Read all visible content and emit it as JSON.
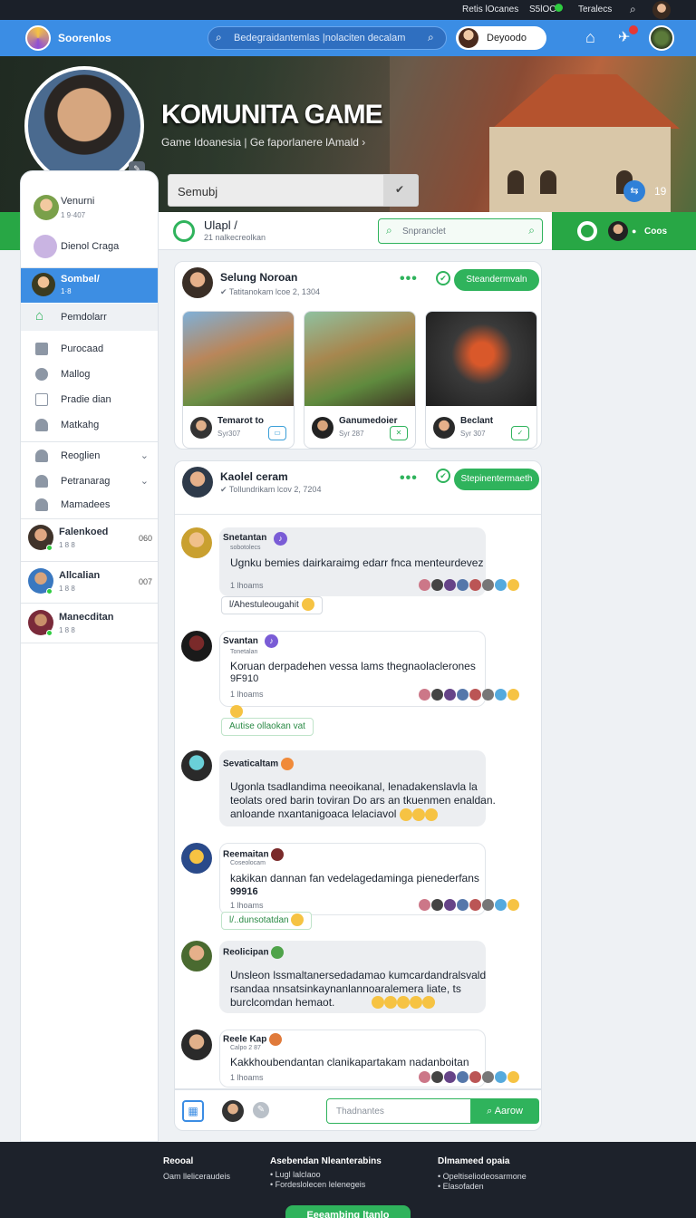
{
  "topbar": {
    "link1": "Retis lOcanes",
    "link2": "S5lOC",
    "link3": "Teralecs"
  },
  "appbar": {
    "brand": "Soorenlos",
    "search_placeholder": "Bedegraidantemlas |nolaciten decalam",
    "user_name": "Deyoodo"
  },
  "hero": {
    "title": "KOMUNITA GAME",
    "subtitle": "Game Idoanesia | Ge faporlanere lAmald",
    "input_value": "Semubj",
    "share_count": "19"
  },
  "sidebar": {
    "profile": {
      "name": "Venurni",
      "sub": "1 9·407"
    },
    "profile2": {
      "name": "Dienol Craga"
    },
    "active": {
      "name": "Sombel/",
      "sub": "1·8"
    },
    "home": "Pemdolarr",
    "menu": [
      "Purocaad",
      "Mallog",
      "Pradie dian",
      "Matkahg"
    ],
    "groups": [
      "Reoglien",
      "Petranarag",
      "Mamadees"
    ],
    "friends": [
      {
        "name": "Falenkoed",
        "sub": "1 8 8",
        "count": "060"
      },
      {
        "name": "Allcalian",
        "sub": "1 8 8",
        "count": "007"
      },
      {
        "name": "Manecditan",
        "sub": "1 8 8",
        "count": ""
      }
    ]
  },
  "main_header": {
    "title": "Ulapl /",
    "subtitle": "21 nalkecreolkan",
    "search_placeholder": "Snpranclet"
  },
  "right_band": {
    "label": "Coos"
  },
  "post1": {
    "author": "Selung Noroan",
    "meta": "Tatitanokam  lcoe 2, 1304",
    "action": "Steandermvaln",
    "thumbs": [
      {
        "name": "Temarot to",
        "sub": "Syr307"
      },
      {
        "name": "Ganumedoier",
        "sub": "Syr 287"
      },
      {
        "name": "Beclant",
        "sub": "Syr 307"
      }
    ]
  },
  "post2": {
    "author": "Kaolel ceram",
    "meta": "Tollundrikam  lcov 2, 7204",
    "action": "Stepinentermaeth"
  },
  "messages": [
    {
      "name": "Snetantan",
      "sub": "sobotolecs",
      "text": "Ugnku bemies dairkaraimg edarr fnca menteurdevez",
      "meta": "1 lhoams",
      "reply": "l/Ahestuleougahit"
    },
    {
      "name": "Svantan",
      "sub": "Tonetalan",
      "text": "Koruan derpadehen vessa lams thegnaolaclerones",
      "extra": "9F910",
      "meta": "1 lhoams",
      "reply": "Autise ollaokan vat"
    },
    {
      "name": "Sevaticaltam",
      "text1": "Ugonla tsadlandima neeoikanal, lenadakenslavla la",
      "text2": "teolats ored barin toviran Do ars an tkuenmen enaldan.",
      "text3": "anloande nxantanigoaca lelaciavol"
    },
    {
      "name": "Reemaitan",
      "sub": "Coseolocam",
      "text": "kakikan dannan fan vedelagedaminga pienederfans",
      "extra": "99916",
      "meta": "1 lhoams",
      "reply": "l/..dunsotatdan"
    },
    {
      "name": "Reolicipan",
      "text1": "Unsleon lssmaltanersedadamao kumcardandralsvald",
      "text2": "rsandaa nnsatsinkaynanlannoaralemera liate, ts",
      "text3": "burclcomdan hemaot."
    },
    {
      "name": "Reele Kap",
      "sub": "Calpo 2 87",
      "text": "Kakkhoubendantan clanikapartakam nadanboitan",
      "meta": "1 lhoams"
    }
  ],
  "compose": {
    "placeholder": "Thadnantes",
    "send_label": "Aarow"
  },
  "footer": {
    "col1": {
      "title": "Reooal",
      "line": "Oam lleliceraudeis"
    },
    "col2": {
      "title": "Asebendan Nleanterabins",
      "lines": [
        "Lugl lalclaoo",
        "Fordeslolecen lelenegeis"
      ]
    },
    "col3": {
      "title": "Dlmameed opaia",
      "lines": [
        "Opeltiseliodeosarmone",
        "Elasofaden"
      ]
    },
    "cta": "Eeeambing ltanlo"
  },
  "colors": {
    "appbar": "#3b8de4",
    "accent_green": "#2fb35c",
    "topbar": "#1b2029"
  }
}
